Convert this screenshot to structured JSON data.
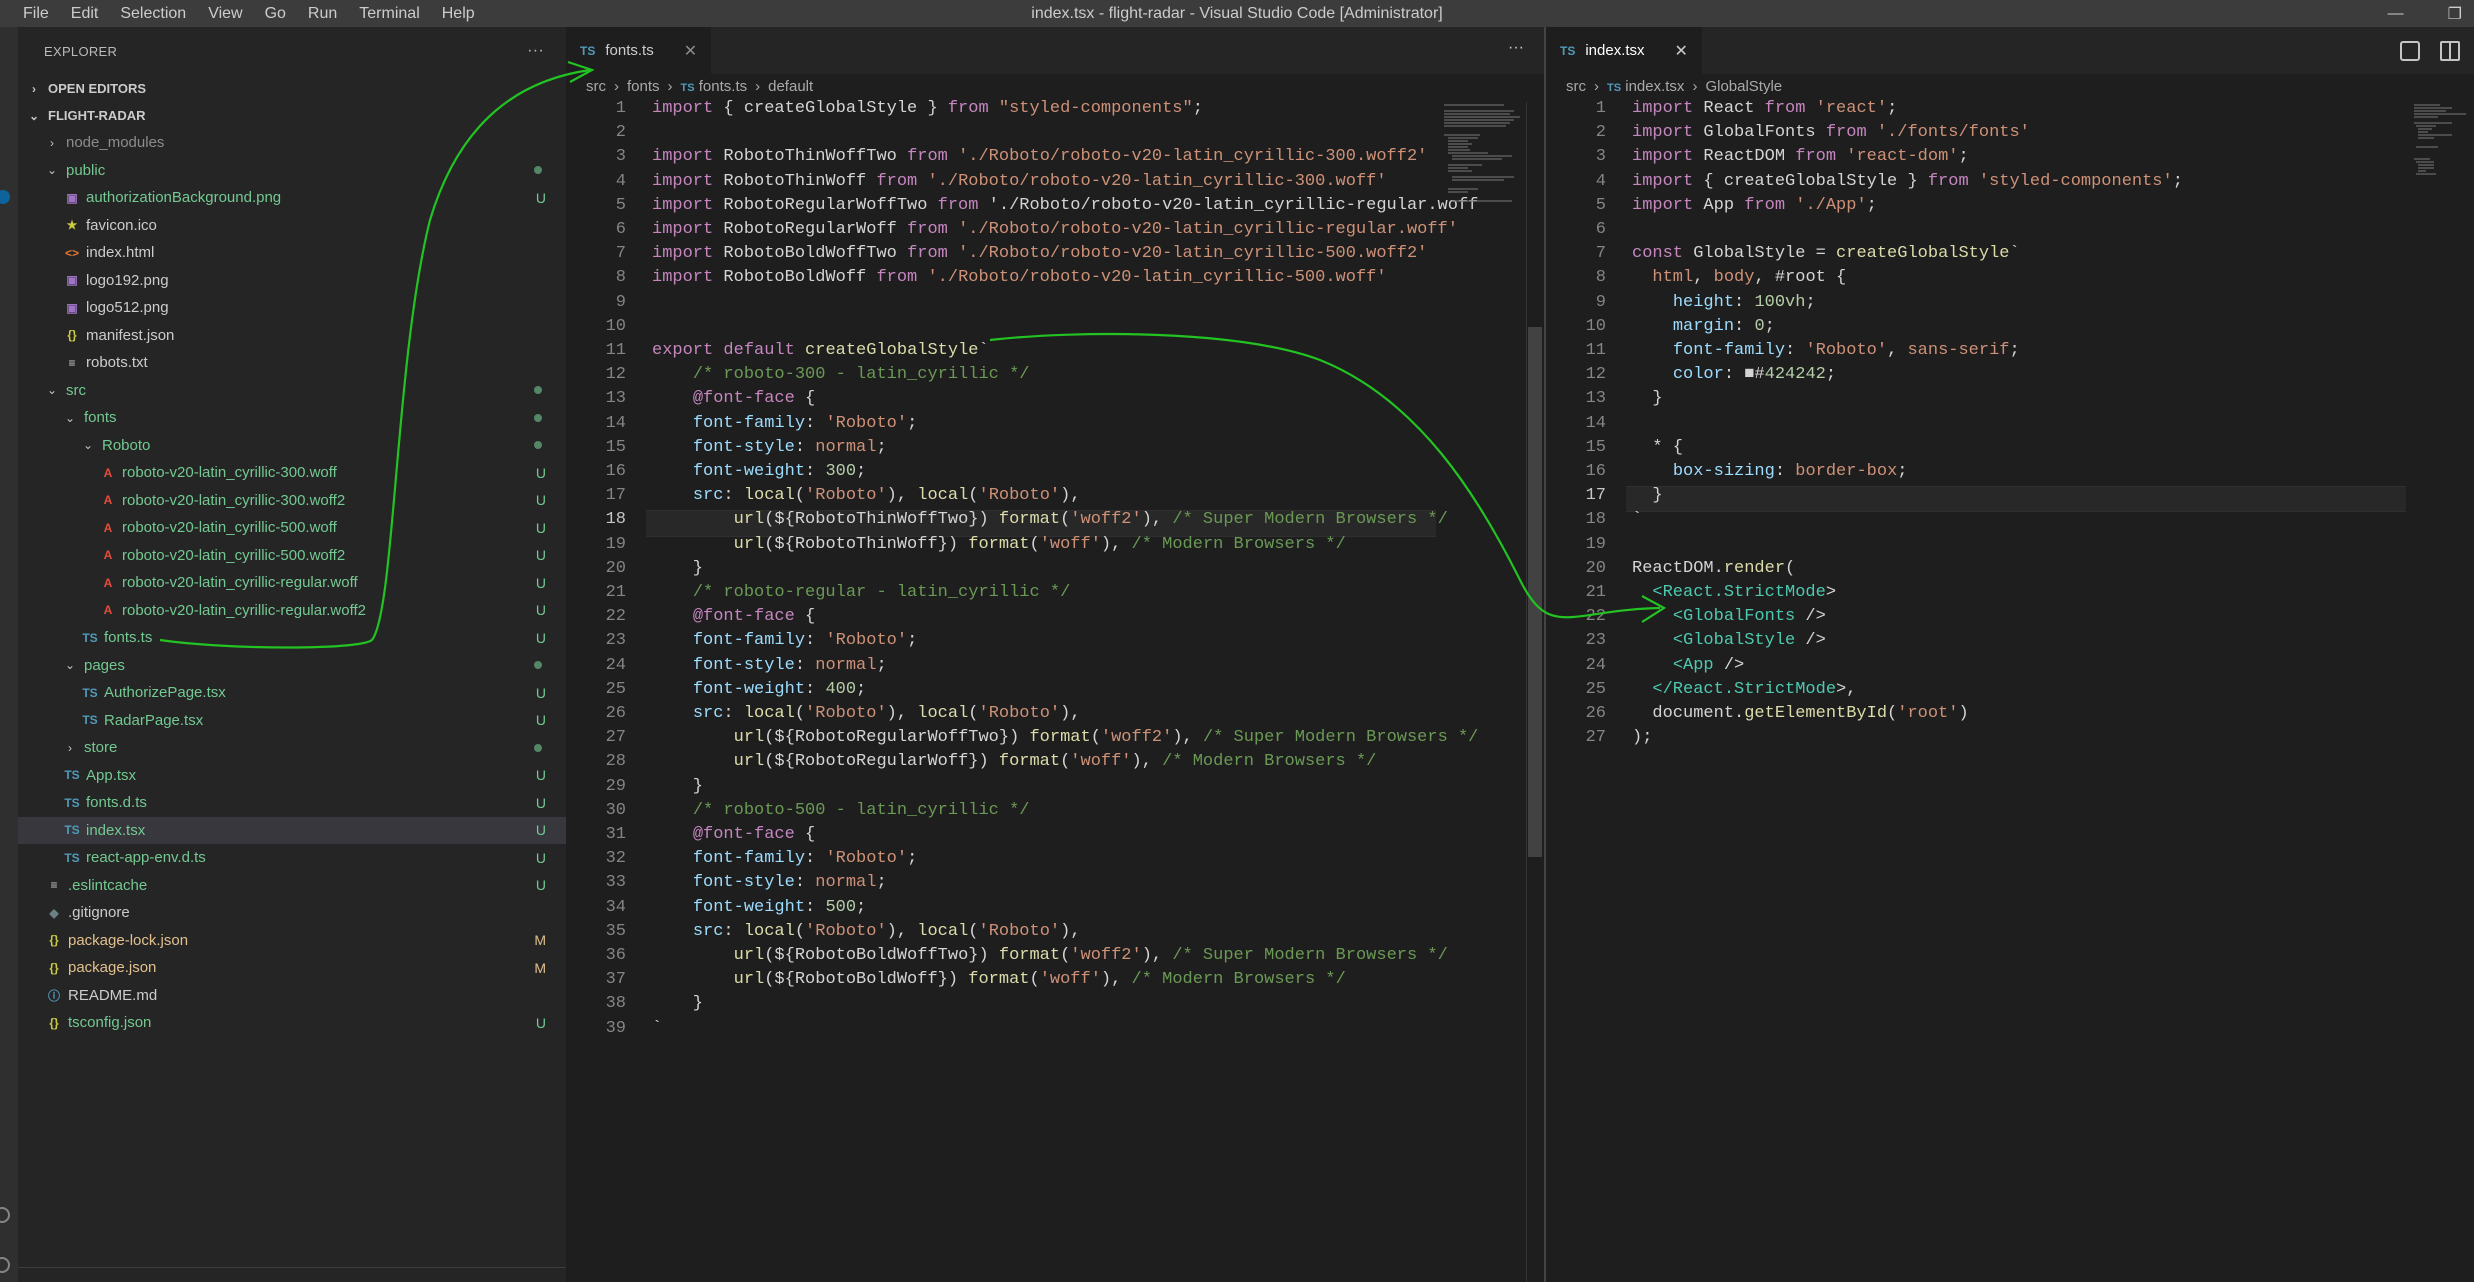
{
  "menu": [
    "File",
    "Edit",
    "Selection",
    "View",
    "Go",
    "Run",
    "Terminal",
    "Help"
  ],
  "window_title": "index.tsx - flight-radar - Visual Studio Code [Administrator]",
  "explorer": {
    "title": "EXPLORER",
    "more": "···",
    "open_editors": "OPEN EDITORS",
    "project": "FLIGHT-RADAR",
    "items": [
      {
        "label": "node_modules",
        "icon": "chevron-right",
        "indent": 1,
        "type": "folder",
        "color": "dim",
        "badge": ""
      },
      {
        "label": "public",
        "icon": "chevron-down",
        "indent": 1,
        "type": "folder",
        "color": "green",
        "badge": "dot"
      },
      {
        "label": "authorizationBackground.png",
        "icon": "image",
        "indent": 2,
        "type": "file",
        "color": "green",
        "badge": "U"
      },
      {
        "label": "favicon.ico",
        "icon": "star",
        "indent": 2,
        "type": "file",
        "color": "plain",
        "badge": ""
      },
      {
        "label": "index.html",
        "icon": "html",
        "indent": 2,
        "type": "file",
        "color": "plain",
        "badge": ""
      },
      {
        "label": "logo192.png",
        "icon": "image",
        "indent": 2,
        "type": "file",
        "color": "plain",
        "badge": ""
      },
      {
        "label": "logo512.png",
        "icon": "image",
        "indent": 2,
        "type": "file",
        "color": "plain",
        "badge": ""
      },
      {
        "label": "manifest.json",
        "icon": "json",
        "indent": 2,
        "type": "file",
        "color": "plain",
        "badge": ""
      },
      {
        "label": "robots.txt",
        "icon": "text",
        "indent": 2,
        "type": "file",
        "color": "plain",
        "badge": ""
      },
      {
        "label": "src",
        "icon": "chevron-down",
        "indent": 1,
        "type": "folder",
        "color": "green",
        "badge": "dot"
      },
      {
        "label": "fonts",
        "icon": "chevron-down",
        "indent": 2,
        "type": "folder",
        "color": "green",
        "badge": "dot"
      },
      {
        "label": "Roboto",
        "icon": "chevron-down",
        "indent": 3,
        "type": "folder",
        "color": "green",
        "badge": "dot"
      },
      {
        "label": "roboto-v20-latin_cyrillic-300.woff",
        "icon": "font",
        "indent": 4,
        "type": "file",
        "color": "green",
        "badge": "U"
      },
      {
        "label": "roboto-v20-latin_cyrillic-300.woff2",
        "icon": "font",
        "indent": 4,
        "type": "file",
        "color": "green",
        "badge": "U"
      },
      {
        "label": "roboto-v20-latin_cyrillic-500.woff",
        "icon": "font",
        "indent": 4,
        "type": "file",
        "color": "green",
        "badge": "U"
      },
      {
        "label": "roboto-v20-latin_cyrillic-500.woff2",
        "icon": "font",
        "indent": 4,
        "type": "file",
        "color": "green",
        "badge": "U"
      },
      {
        "label": "roboto-v20-latin_cyrillic-regular.woff",
        "icon": "font",
        "indent": 4,
        "type": "file",
        "color": "green",
        "badge": "U"
      },
      {
        "label": "roboto-v20-latin_cyrillic-regular.woff2",
        "icon": "font",
        "indent": 4,
        "type": "file",
        "color": "green",
        "badge": "U"
      },
      {
        "label": "fonts.ts",
        "icon": "ts",
        "indent": 3,
        "type": "file",
        "color": "green",
        "badge": "U"
      },
      {
        "label": "pages",
        "icon": "chevron-down",
        "indent": 2,
        "type": "folder",
        "color": "green",
        "badge": "dot"
      },
      {
        "label": "AuthorizePage.tsx",
        "icon": "ts",
        "indent": 3,
        "type": "file",
        "color": "green",
        "badge": "U"
      },
      {
        "label": "RadarPage.tsx",
        "icon": "ts",
        "indent": 3,
        "type": "file",
        "color": "green",
        "badge": "U"
      },
      {
        "label": "store",
        "icon": "chevron-right",
        "indent": 2,
        "type": "folder",
        "color": "green",
        "badge": "dot"
      },
      {
        "label": "App.tsx",
        "icon": "ts",
        "indent": 2,
        "type": "file",
        "color": "green",
        "badge": "U"
      },
      {
        "label": "fonts.d.ts",
        "icon": "ts",
        "indent": 2,
        "type": "file",
        "color": "green",
        "badge": "U"
      },
      {
        "label": "index.tsx",
        "icon": "ts",
        "indent": 2,
        "type": "file",
        "color": "green",
        "badge": "U",
        "selected": true
      },
      {
        "label": "react-app-env.d.ts",
        "icon": "ts",
        "indent": 2,
        "type": "file",
        "color": "green",
        "badge": "U"
      },
      {
        "label": ".eslintcache",
        "icon": "text",
        "indent": 1,
        "type": "file",
        "color": "green",
        "badge": "U"
      },
      {
        "label": ".gitignore",
        "icon": "gear",
        "indent": 1,
        "type": "file",
        "color": "plain",
        "badge": ""
      },
      {
        "label": "package-lock.json",
        "icon": "json",
        "indent": 1,
        "type": "file",
        "color": "mod",
        "badge": "M"
      },
      {
        "label": "package.json",
        "icon": "json",
        "indent": 1,
        "type": "file",
        "color": "mod",
        "badge": "M"
      },
      {
        "label": "README.md",
        "icon": "info",
        "indent": 1,
        "type": "file",
        "color": "plain",
        "badge": ""
      },
      {
        "label": "tsconfig.json",
        "icon": "json",
        "indent": 1,
        "type": "file",
        "color": "green",
        "badge": "U"
      }
    ]
  },
  "left_editor": {
    "tab": {
      "lang": "TS",
      "label": "fonts.ts",
      "close": "✕"
    },
    "more": "···",
    "breadcrumb": [
      "src",
      "fonts",
      "TS fonts.ts",
      "default"
    ],
    "current_line": 18,
    "lines": [
      "import { createGlobalStyle } from \"styled-components\";",
      "",
      "import RobotoThinWoffTwo from './Roboto/roboto-v20-latin_cyrillic-300.woff2'",
      "import RobotoThinWoff from './Roboto/roboto-v20-latin_cyrillic-300.woff'",
      "import RobotoRegularWoffTwo from './Roboto/roboto-v20-latin_cyrillic-regular.woff",
      "import RobotoRegularWoff from './Roboto/roboto-v20-latin_cyrillic-regular.woff'",
      "import RobotoBoldWoffTwo from './Roboto/roboto-v20-latin_cyrillic-500.woff2'",
      "import RobotoBoldWoff from './Roboto/roboto-v20-latin_cyrillic-500.woff'",
      "",
      "",
      "export default createGlobalStyle`",
      "    /* roboto-300 - latin_cyrillic */",
      "    @font-face {",
      "    font-family: 'Roboto';",
      "    font-style: normal;",
      "    font-weight: 300;",
      "    src: local('Roboto'), local('Roboto'),",
      "        url(${RobotoThinWoffTwo}) format('woff2'), /* Super Modern Browsers */",
      "        url(${RobotoThinWoff}) format('woff'), /* Modern Browsers */",
      "    }",
      "    /* roboto-regular - latin_cyrillic */",
      "    @font-face {",
      "    font-family: 'Roboto';",
      "    font-style: normal;",
      "    font-weight: 400;",
      "    src: local('Roboto'), local('Roboto'),",
      "        url(${RobotoRegularWoffTwo}) format('woff2'), /* Super Modern Browsers */",
      "        url(${RobotoRegularWoff}) format('woff'), /* Modern Browsers */",
      "    }",
      "    /* roboto-500 - latin_cyrillic */",
      "    @font-face {",
      "    font-family: 'Roboto';",
      "    font-style: normal;",
      "    font-weight: 500;",
      "    src: local('Roboto'), local('Roboto'),",
      "        url(${RobotoBoldWoffTwo}) format('woff2'), /* Super Modern Browsers */",
      "        url(${RobotoBoldWoff}) format('woff'), /* Modern Browsers */",
      "    }",
      "`"
    ]
  },
  "right_editor": {
    "tab": {
      "lang": "TS",
      "label": "index.tsx",
      "close": "✕"
    },
    "breadcrumb": [
      "src",
      "TS index.tsx",
      "GlobalStyle"
    ],
    "current_line": 17,
    "lines": [
      "import React from 'react';",
      "import GlobalFonts from './fonts/fonts'",
      "import ReactDOM from 'react-dom';",
      "import { createGlobalStyle } from 'styled-components';",
      "import App from './App';",
      "",
      "const GlobalStyle = createGlobalStyle`",
      "  html, body, #root {",
      "    height: 100vh;",
      "    margin: 0;",
      "    font-family: 'Roboto', sans-serif;",
      "    color: ■#424242;",
      "  }",
      "",
      "  * {",
      "    box-sizing: border-box;",
      "  }",
      "`",
      "",
      "ReactDOM.render(",
      "  <React.StrictMode>",
      "    <GlobalFonts />",
      "    <GlobalStyle />",
      "    <App />",
      "  </React.StrictMode>,",
      "  document.getElementById('root')",
      ");"
    ]
  },
  "colors": {
    "annotation": "#22c322",
    "ts_icon": "#519aba",
    "untracked": "#73c991",
    "modified": "#e2c08d"
  }
}
